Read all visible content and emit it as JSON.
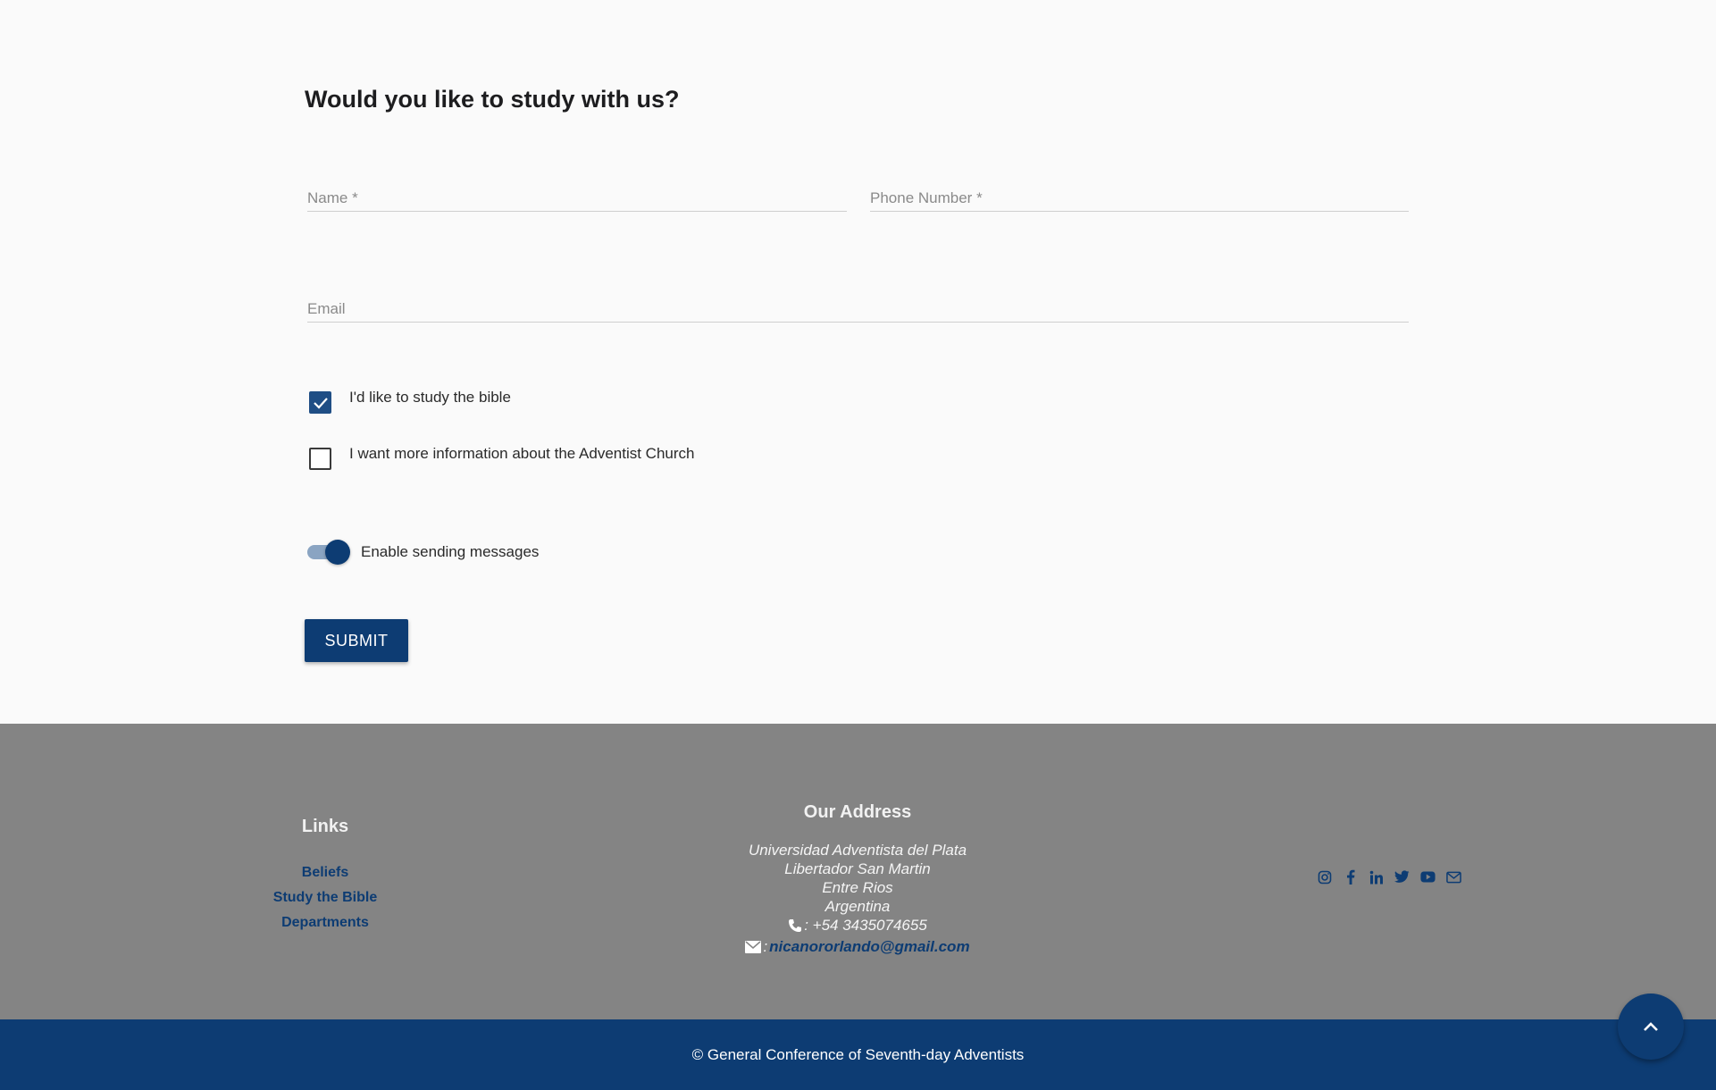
{
  "form": {
    "title": "Would you like to study with us?",
    "name_placeholder": "Name *",
    "name_value": "",
    "phone_placeholder": "Phone Number *",
    "phone_value": "",
    "email_placeholder": "Email",
    "email_value": "",
    "checkboxes": [
      {
        "label": "I'd like to study the bible",
        "checked": true
      },
      {
        "label": "I want more information about the Adventist Church",
        "checked": false
      }
    ],
    "toggle": {
      "label": "Enable sending messages",
      "on": true
    },
    "submit_label": "SUBMIT"
  },
  "footer": {
    "links_title": "Links",
    "links": [
      "Beliefs",
      "Study the Bible",
      "Departments"
    ],
    "address_title": "Our Address",
    "address_lines": [
      "Universidad Adventista del Plata",
      "Libertador San Martin",
      "Entre Rios",
      "Argentina"
    ],
    "phone": ": +54 3435074655",
    "email_prefix": ":",
    "email": "nicanororlando@gmail.com",
    "social_icons": [
      "instagram-icon",
      "facebook-icon",
      "linkedin-icon",
      "twitter-icon",
      "youtube-icon",
      "envelope-icon"
    ],
    "copyright": "© General Conference of Seventh-day Adventists"
  },
  "colors": {
    "primary": "#0d3c73",
    "footer_bg": "#848484",
    "page_bg": "#fafafa"
  }
}
